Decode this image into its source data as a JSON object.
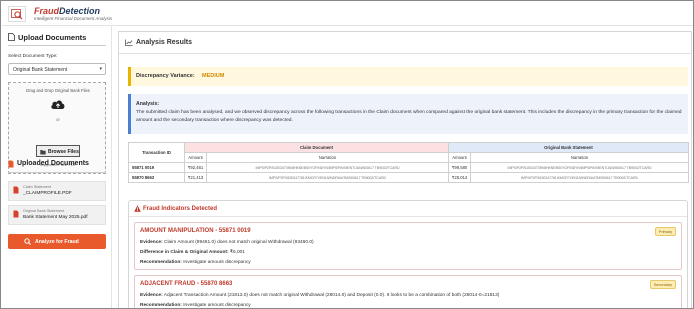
{
  "app": {
    "brand_part1": "Fraud",
    "brand_part2": "Detection",
    "tagline": "Intelligent Financial Document Analysis"
  },
  "sidebar": {
    "upload_heading": "Upload Documents",
    "select_label": "Select Document Type:",
    "select_value": "Original Bank Statement",
    "drop_text": "Drag and Drop Original Bank Files",
    "drop_or": "or",
    "browse_label": "Browse Files",
    "supported": "Supported Files: PDF",
    "uploaded_heading": "Uploaded Documents",
    "documents": [
      {
        "type": "Claim Statement",
        "name": "_CLAIMPROFILE.PDF"
      },
      {
        "type": "Original Bank Statement",
        "name": "Bank Statement May 2025.pdf"
      }
    ],
    "analyze_label": "Analyze for Fraud"
  },
  "main": {
    "heading": "Analysis Results",
    "variance_label": "Discrepancy Variance:",
    "variance_value": "MEDIUM",
    "analysis_heading": "Analysis:",
    "analysis_text": "The submitted claim has been analysed, and we observed discrepancy across the following transactions in the Claim document when compared against the original bank statement. This includes the discrepancy in the primary transaction for the claimed amount and the secondary transaction where discrepancy was detected."
  },
  "table": {
    "col_tid": "Transaction ID",
    "group_claim": "Claim Document",
    "group_orig": "Original Bank Statement",
    "col_amount": "Amount",
    "col_narration": "Narration",
    "rows": [
      {
        "tid": "55871 0019",
        "claim_amount": "₹92,461",
        "claim_narration": "IMPS/P2P/5150347789/8HKNEBS0YOFINDYN/IMPS/PAYMENT/JAN/500617 TB9002/TCARD",
        "orig_amount": "₹99,580",
        "orig_narration": "IMPS/P2P/5150347789/8HKNEBS0YOFINDYN/IMPS/PAYMENT/JAN/500617 TB9002/TCARD"
      },
      {
        "tid": "55870 8663",
        "claim_amount": "₹21,413",
        "claim_narration": "IMPS/P2P/5150347781/KMCR7VEN15/INDRA/ATM/500617 TB9002/TCARD",
        "orig_amount": "₹28,014",
        "orig_narration": "IMPS/P2P/5150347781/KMCR7VEN15/INDRA/ATM/500617 TB9002/TCARD"
      }
    ]
  },
  "fraud": {
    "heading": "Fraud Indicators Detected",
    "cards": [
      {
        "title": "AMOUNT MANIPULATION - 55871 0019",
        "badge": "Primary",
        "evidence_label": "Evidence:",
        "evidence": "Claim Amount (99461.0) does not match original Withdrawal (93460.0)",
        "diff_label": "Difference in Claim & Original Amount:",
        "diff": "₹6,001",
        "rec_label": "Recommendation:",
        "rec": "Investigate amount discrepancy"
      },
      {
        "title": "ADJACENT FRAUD - 55870 8663",
        "badge": "Secondary",
        "evidence_label": "Evidence:",
        "evidence": "Adjacent Transaction Amount (21813.0) does not match original Withdrawal (28014.0) and Deposit (0.0). It looks to be a combination of both (28014-0=21813)",
        "rec_label": "Recommendation:",
        "rec": "Investigate amount discrepancy"
      }
    ]
  },
  "colors": {
    "brand_red": "#c0392b",
    "accent_orange": "#e85a2c",
    "variance_medium": "#d18a00"
  }
}
